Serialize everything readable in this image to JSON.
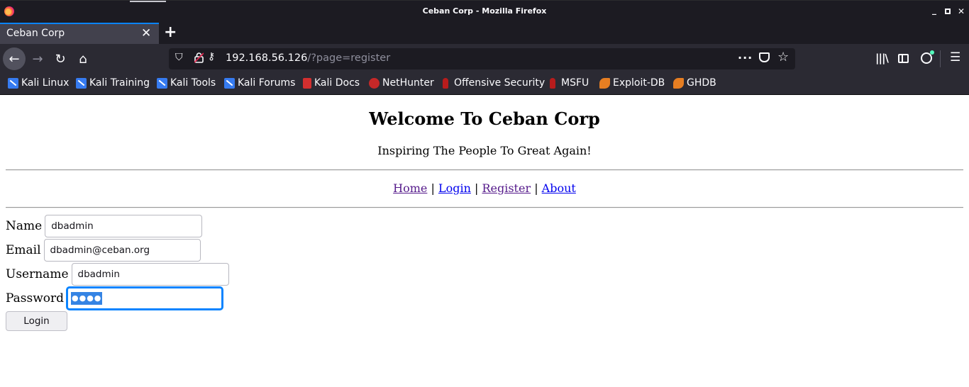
{
  "window": {
    "title": "Ceban Corp - Mozilla Firefox"
  },
  "tab": {
    "label": "Ceban Corp"
  },
  "url": {
    "host": "192.168.56.126",
    "path": "/?page=register"
  },
  "bookmarks": [
    {
      "label": "Kali Linux",
      "icon": "kali-icon"
    },
    {
      "label": "Kali Training",
      "icon": "kali-icon"
    },
    {
      "label": "Kali Tools",
      "icon": "kali-icon"
    },
    {
      "label": "Kali Forums",
      "icon": "kali-icon"
    },
    {
      "label": "Kali Docs",
      "icon": "docs-icon"
    },
    {
      "label": "NetHunter",
      "icon": "nethunter-icon"
    },
    {
      "label": "Offensive Security",
      "icon": "offsec-icon"
    },
    {
      "label": "MSFU",
      "icon": "offsec-icon"
    },
    {
      "label": "Exploit-DB",
      "icon": "exploitdb-icon"
    },
    {
      "label": "GHDB",
      "icon": "exploitdb-icon"
    }
  ],
  "page": {
    "heading": "Welcome To Ceban Corp",
    "tagline": "Inspiring The People To Great Again!",
    "nav": {
      "home": "Home",
      "login": "Login",
      "register": "Register",
      "about": "About",
      "separator": "|"
    },
    "form": {
      "name_label": "Name",
      "name_value": "dbadmin",
      "email_label": "Email",
      "email_value": "dbadmin@ceban.org",
      "username_label": "Username",
      "username_value": "dbadmin",
      "password_label": "Password",
      "password_mask": "●●●●",
      "submit_label": "Login"
    }
  },
  "colors": {
    "focus": "#0a84ff",
    "link": "#0000ee",
    "link_visited": "#551a8b",
    "chrome_dark": "#1c1b22",
    "toolbar": "#2b2a33"
  }
}
